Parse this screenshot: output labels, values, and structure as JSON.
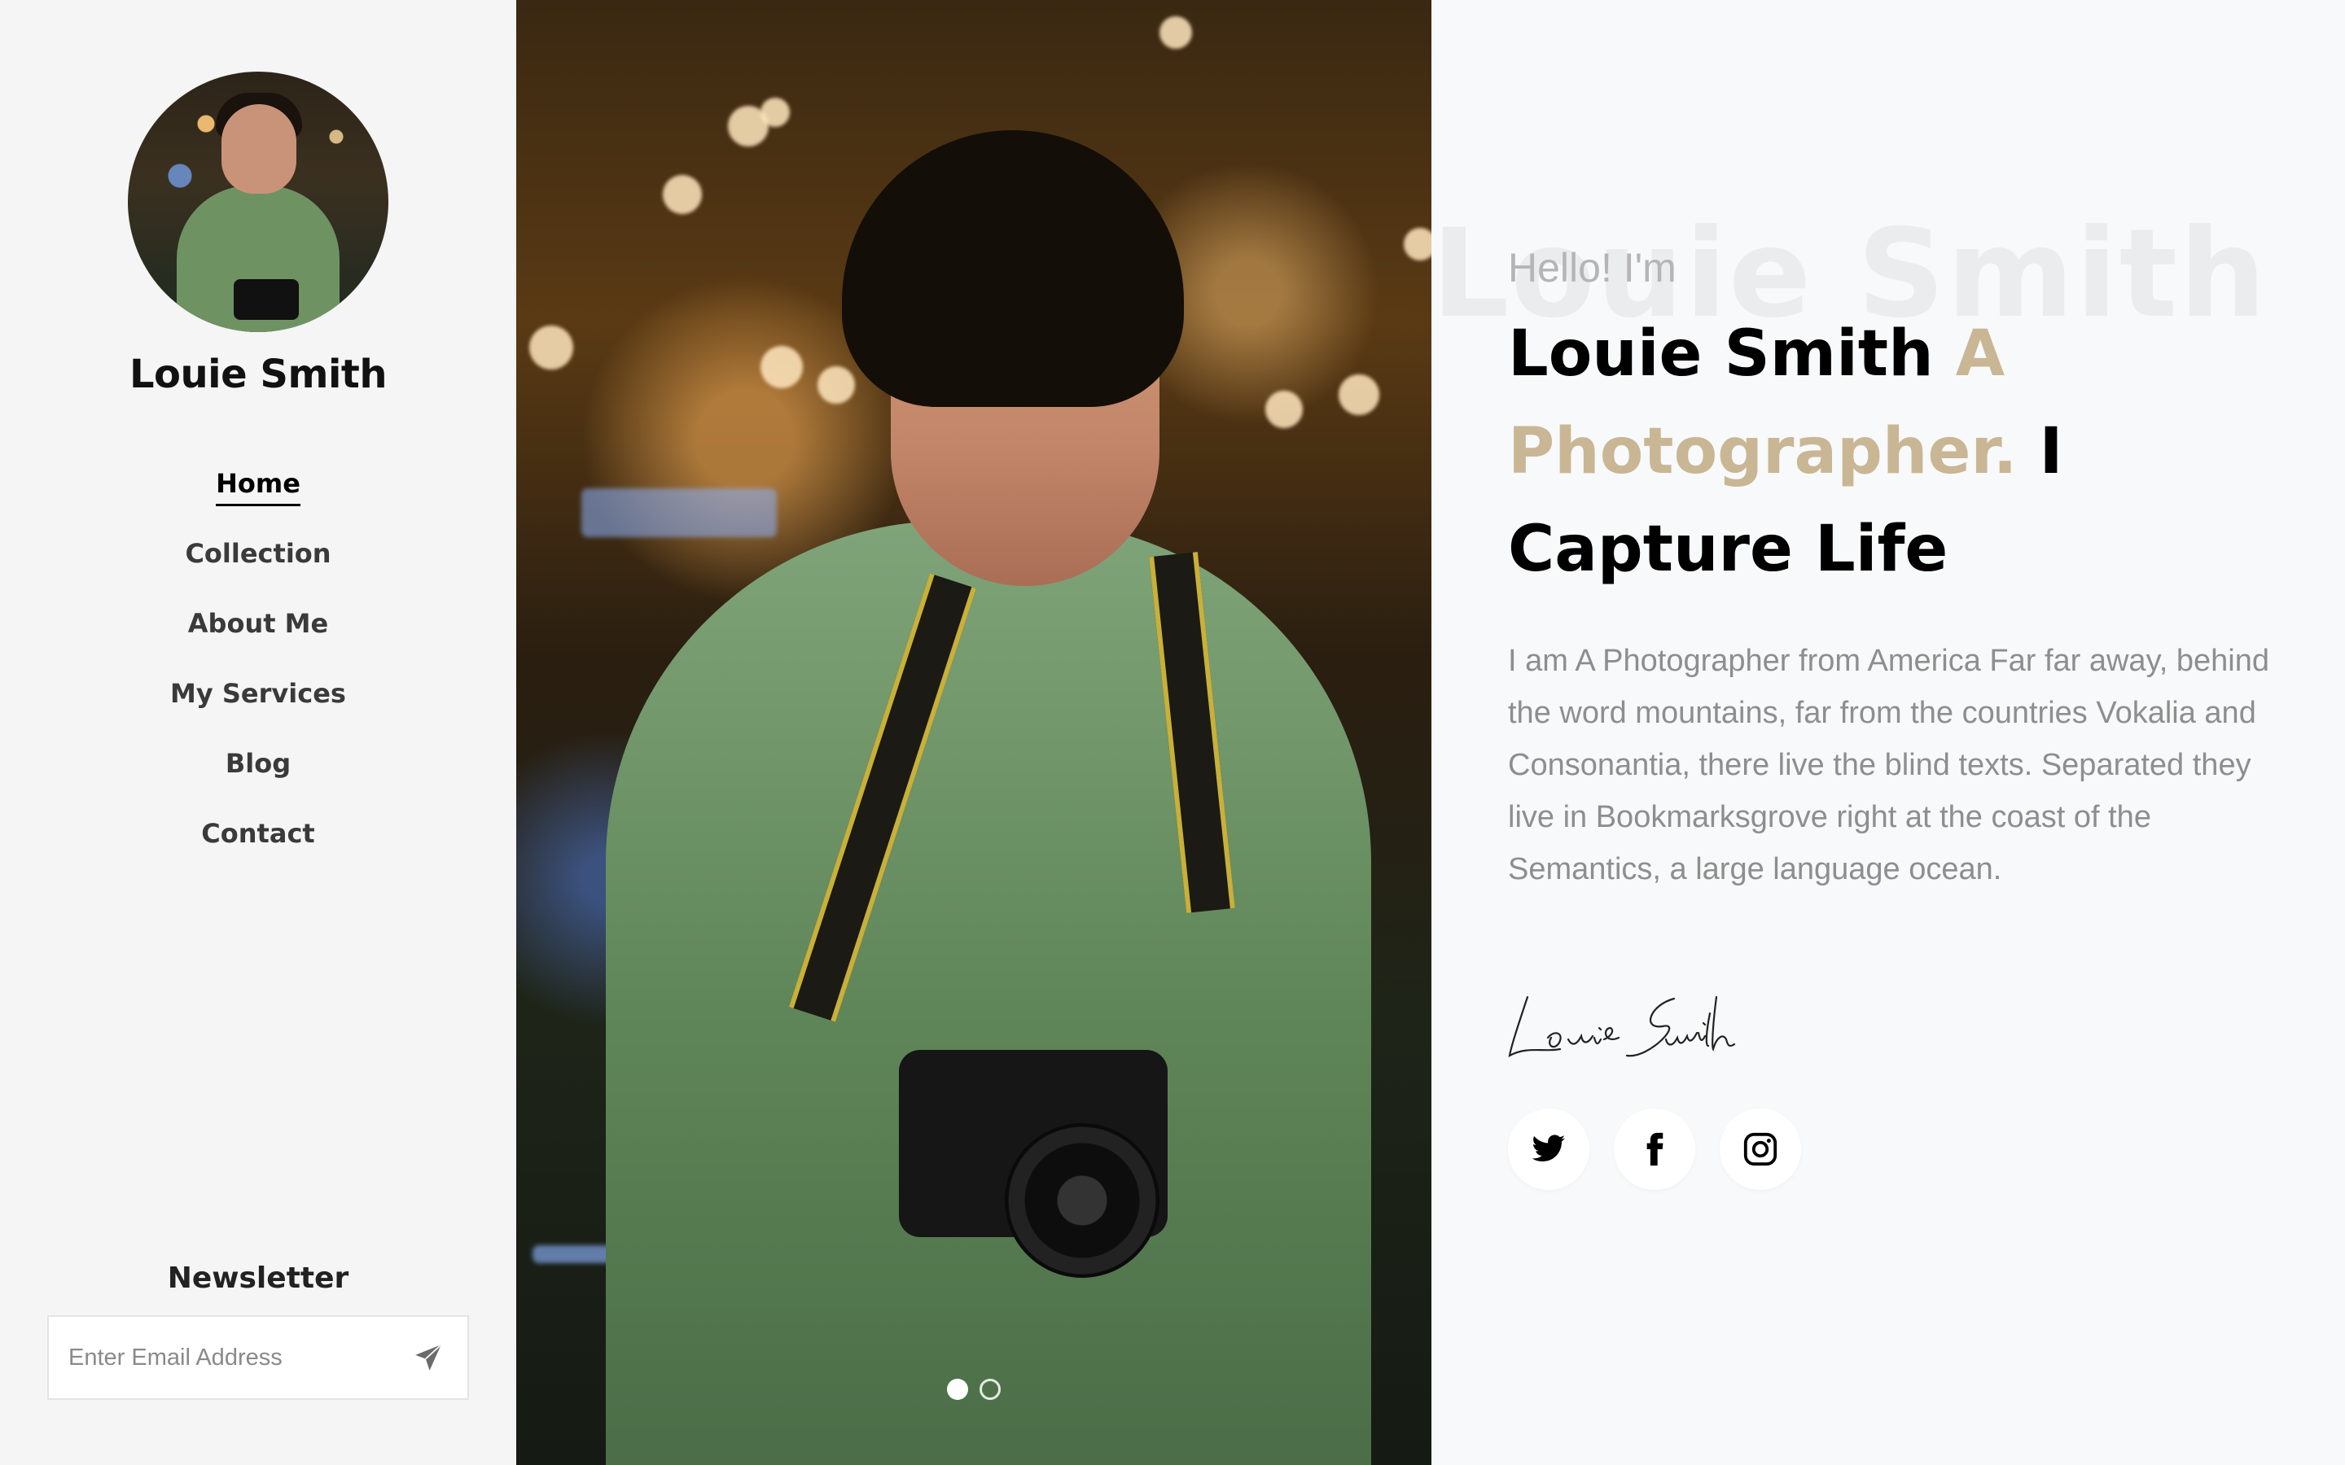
{
  "sidebar": {
    "profile_name": "Louie Smith",
    "nav": [
      {
        "label": "Home",
        "active": true
      },
      {
        "label": "Collection",
        "active": false
      },
      {
        "label": "About Me",
        "active": false
      },
      {
        "label": "My Services",
        "active": false
      },
      {
        "label": "Blog",
        "active": false
      },
      {
        "label": "Contact",
        "active": false
      }
    ],
    "newsletter": {
      "title": "Newsletter",
      "placeholder": "Enter Email Address",
      "submit_icon": "paper-plane-icon"
    }
  },
  "hero": {
    "slides": 2,
    "active_slide": 1
  },
  "intro": {
    "background_text": "Louie Smith",
    "greeting": "Hello! I'm",
    "headline_name": "Louie Smith",
    "headline_accent": "A Photographer.",
    "headline_rest": "I Capture Life",
    "bio": "I am A Photographer from America Far far away, behind the word mountains, far from the countries Vokalia and Consonantia, there live the blind texts. Separated they live in Bookmarksgrove right at the coast of the Semantics, a large language ocean.",
    "signature": "Louie Smith",
    "social": [
      {
        "name": "twitter",
        "icon": "twitter-icon"
      },
      {
        "name": "facebook",
        "icon": "facebook-icon"
      },
      {
        "name": "instagram",
        "icon": "instagram-icon"
      }
    ]
  },
  "colors": {
    "accent": "#c9b694",
    "text_dark": "#000000",
    "text_muted": "#8e8e8e",
    "sidebar_bg": "#f5f5f5",
    "page_bg": "#f8f9fa"
  }
}
